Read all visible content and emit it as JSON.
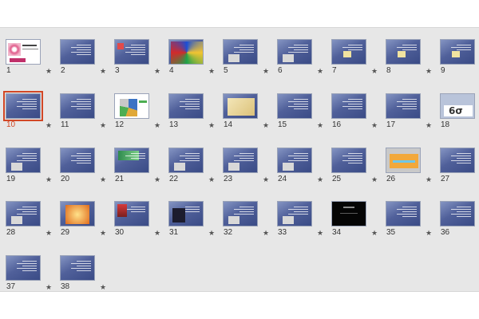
{
  "selected_slide": 10,
  "star_glyph": "★",
  "slides": [
    {
      "num": "1",
      "thumb": "title-white-pink-swirl"
    },
    {
      "num": "2",
      "thumb": "text"
    },
    {
      "num": "3",
      "thumb": "text-logo"
    },
    {
      "num": "4",
      "thumb": "colorful-image"
    },
    {
      "num": "5",
      "thumb": "text-image"
    },
    {
      "num": "6",
      "thumb": "text-image"
    },
    {
      "num": "7",
      "thumb": "text-small-image"
    },
    {
      "num": "8",
      "thumb": "text-small-image"
    },
    {
      "num": "9",
      "thumb": "text-small-image"
    },
    {
      "num": "10",
      "thumb": "text"
    },
    {
      "num": "11",
      "thumb": "text"
    },
    {
      "num": "12",
      "thumb": "white-pie-chart"
    },
    {
      "num": "13",
      "thumb": "text"
    },
    {
      "num": "14",
      "thumb": "map-image"
    },
    {
      "num": "15",
      "thumb": "text"
    },
    {
      "num": "16",
      "thumb": "text"
    },
    {
      "num": "17",
      "thumb": "text"
    },
    {
      "num": "18",
      "thumb": "symbol-6sigma"
    },
    {
      "num": "19",
      "thumb": "text-image"
    },
    {
      "num": "20",
      "thumb": "text"
    },
    {
      "num": "21",
      "thumb": "green-image"
    },
    {
      "num": "22",
      "thumb": "text-image"
    },
    {
      "num": "23",
      "thumb": "text-image"
    },
    {
      "num": "24",
      "thumb": "text-image"
    },
    {
      "num": "25",
      "thumb": "text"
    },
    {
      "num": "26",
      "thumb": "orange-box"
    },
    {
      "num": "27",
      "thumb": "text"
    },
    {
      "num": "28",
      "thumb": "text-image"
    },
    {
      "num": "29",
      "thumb": "orange-image"
    },
    {
      "num": "30",
      "thumb": "red-image"
    },
    {
      "num": "31",
      "thumb": "dark-image"
    },
    {
      "num": "32",
      "thumb": "text-image"
    },
    {
      "num": "33",
      "thumb": "text-image"
    },
    {
      "num": "34",
      "thumb": "black-slide"
    },
    {
      "num": "35",
      "thumb": "text"
    },
    {
      "num": "36",
      "thumb": "text"
    },
    {
      "num": "37",
      "thumb": "text"
    },
    {
      "num": "38",
      "thumb": "text"
    }
  ]
}
